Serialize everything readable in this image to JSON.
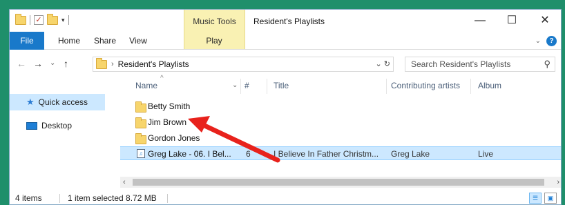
{
  "window": {
    "title": "Resident's Playlists",
    "context_tab": "Music Tools",
    "controls": {
      "minimize": "—",
      "maximize": "☐",
      "close": "✕"
    }
  },
  "ribbon": {
    "tabs": [
      {
        "label": "File"
      },
      {
        "label": "Home"
      },
      {
        "label": "Share"
      },
      {
        "label": "View"
      },
      {
        "label": "Play"
      }
    ],
    "help": "?"
  },
  "address": {
    "crumb": "Resident's Playlists",
    "search_placeholder": "Search Resident's Playlists"
  },
  "navpane": {
    "items": [
      {
        "label": "Quick access",
        "icon": "star-icon"
      },
      {
        "label": "Desktop",
        "icon": "desktop-icon"
      }
    ]
  },
  "columns": {
    "name": "Name",
    "number": "#",
    "title": "Title",
    "artists": "Contributing artists",
    "album": "Album"
  },
  "rows": [
    {
      "name": "Betty Smith",
      "type": "folder"
    },
    {
      "name": "Jim Brown",
      "type": "folder"
    },
    {
      "name": "Gordon Jones",
      "type": "folder"
    },
    {
      "name": "Greg Lake - 06. I Bel...",
      "type": "audio",
      "number": "6",
      "title": "I Believe In Father Christm...",
      "artists": "Greg Lake",
      "album": "Live",
      "selected": true
    }
  ],
  "status": {
    "items": "4 items",
    "selection": "1 item selected  8.72 MB"
  },
  "annotation": {
    "color": "#e8221c"
  }
}
